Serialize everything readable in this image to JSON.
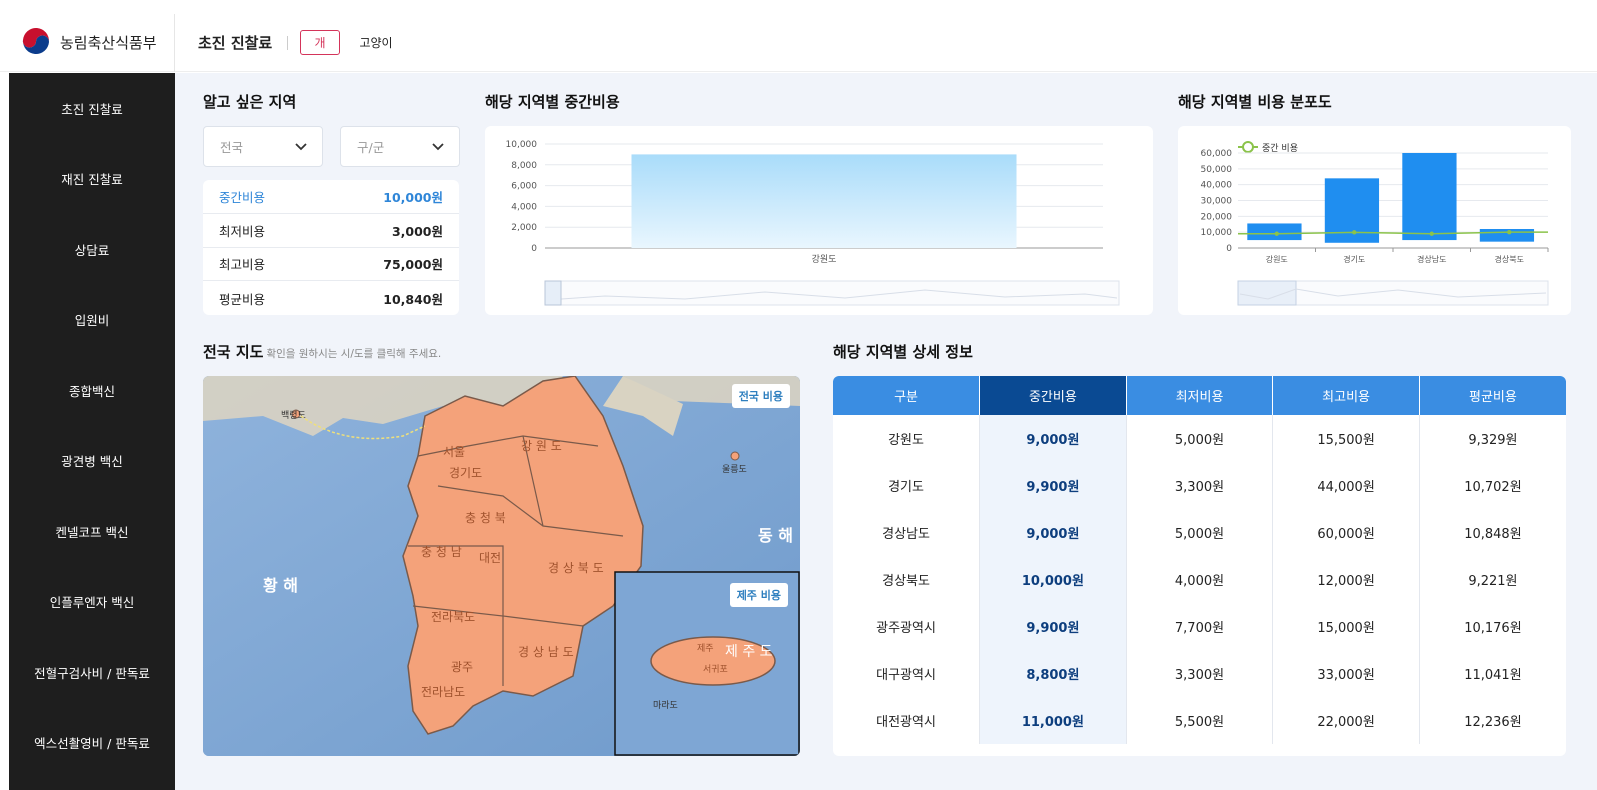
{
  "brand": {
    "name": "농림축산식품부"
  },
  "header": {
    "title": "초진 진찰료",
    "pet_tabs": [
      "개",
      "고양이"
    ]
  },
  "sidebar": {
    "items": [
      "초진 진찰료",
      "재진 진찰료",
      "상담료",
      "입원비",
      "종합백신",
      "광견병 백신",
      "켄넬코프 백신",
      "인플루엔자 백신",
      "전혈구검사비 / 판독료",
      "엑스선촬영비 / 판독료"
    ]
  },
  "region": {
    "title": "알고 싶은 지역",
    "province_select": "전국",
    "district_select": "구/군",
    "stats": [
      {
        "label": "중간비용",
        "value": "10,000원"
      },
      {
        "label": "최저비용",
        "value": "3,000원"
      },
      {
        "label": "최고비용",
        "value": "75,000원"
      },
      {
        "label": "평균비용",
        "value": "10,840원"
      }
    ]
  },
  "median_chart": {
    "title": "해당 지역별 중간비용"
  },
  "dist_chart": {
    "title": "해당 지역별 비용 분포도",
    "legend": "중간 비용"
  },
  "map": {
    "title": "전국 지도",
    "hint": "확인을 원하시는 시/도를 클릭해 주세요.",
    "national_badge": "전국 비용",
    "jeju_badge": "제주 비용",
    "labels": {
      "sea_west": "황 해",
      "sea_east": "동 해",
      "ulleungdo": "울릉도",
      "baengnyeong": "백령도",
      "marado": "마라도",
      "jeju": "제 주 도",
      "jeju_city": "제주",
      "seogwipo": "서귀포",
      "seoul": "서울",
      "gyeonggi": "경기도",
      "gangwon": "강 원 도",
      "chungbuk": "충 청 북",
      "chungnam": "충 청 남",
      "daejeon": "대전",
      "gyeongbuk": "경 상 북 도",
      "jeonbuk": "전라북도",
      "jeonnam": "전라남도",
      "gyeongnam": "경 상 남 도",
      "gwangju": "광주"
    }
  },
  "detail": {
    "title": "해당 지역별 상세 정보",
    "columns": [
      "구분",
      "중간비용",
      "최저비용",
      "최고비용",
      "평균비용"
    ],
    "rows": [
      [
        "강원도",
        "9,000원",
        "5,000원",
        "15,500원",
        "9,329원"
      ],
      [
        "경기도",
        "9,900원",
        "3,300원",
        "44,000원",
        "10,702원"
      ],
      [
        "경상남도",
        "9,000원",
        "5,000원",
        "60,000원",
        "10,848원"
      ],
      [
        "경상북도",
        "10,000원",
        "4,000원",
        "12,000원",
        "9,221원"
      ],
      [
        "광주광역시",
        "9,900원",
        "7,700원",
        "15,000원",
        "10,176원"
      ],
      [
        "대구광역시",
        "8,800원",
        "3,300원",
        "33,000원",
        "11,041원"
      ],
      [
        "대전광역시",
        "11,000원",
        "5,500원",
        "22,000원",
        "12,236원"
      ]
    ]
  },
  "chart_data": [
    {
      "type": "bar",
      "title": "해당 지역별 중간비용",
      "categories": [
        "강원도"
      ],
      "values": [
        9000
      ],
      "ylim": [
        0,
        10000
      ],
      "yticks": [
        0,
        2000,
        4000,
        6000,
        8000,
        10000
      ],
      "ytick_labels": [
        "0",
        "2,000",
        "4,000",
        "6,000",
        "8,000",
        "10,000"
      ],
      "grid": true
    },
    {
      "type": "bar",
      "title": "해당 지역별 비용 분포도",
      "categories": [
        "강원도",
        "경기도",
        "경상남도",
        "경상북도"
      ],
      "series": [
        {
          "range_low": [
            5000,
            3300,
            5000,
            4000
          ],
          "range_high": [
            15500,
            44000,
            60000,
            12000
          ]
        },
        {
          "name": "중간 비용",
          "type": "line",
          "values": [
            9000,
            9900,
            9000,
            10000
          ]
        }
      ],
      "ylim": [
        0,
        60000
      ],
      "yticks": [
        0,
        10000,
        20000,
        30000,
        40000,
        50000,
        60000
      ],
      "ytick_labels": [
        "0",
        "10,000",
        "20,000",
        "30,000",
        "40,000",
        "50,000",
        "60,000"
      ],
      "legend": "top-left",
      "grid": true
    }
  ],
  "colors": {
    "accent": "#3a8de2",
    "median_header": "#0a4a93",
    "active_tab": "#d4345a",
    "sidebar": "#1e1e1e",
    "bar_light": "#bfe4fb",
    "bar": "#1f8ef0",
    "line": "#8bc34a",
    "land": "#f4a27a"
  }
}
